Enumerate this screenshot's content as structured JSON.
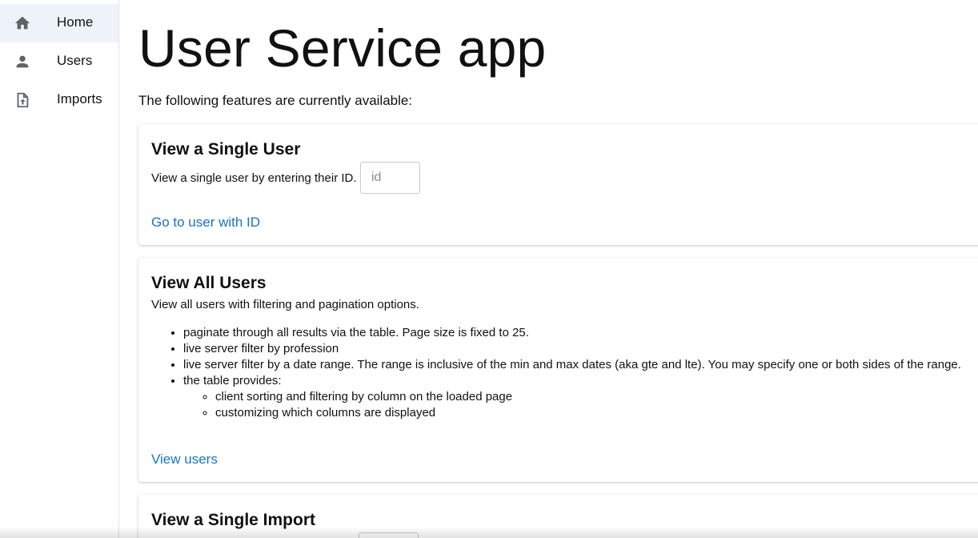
{
  "sidebar": {
    "items": [
      {
        "label": "Home",
        "icon": "home-icon",
        "active": true
      },
      {
        "label": "Users",
        "icon": "person-icon",
        "active": false
      },
      {
        "label": "Imports",
        "icon": "file-upload-icon",
        "active": false
      }
    ]
  },
  "main": {
    "title": "User Service app",
    "intro": "The following features are currently available:",
    "cards": {
      "single_user": {
        "title": "View a Single User",
        "description": "View a single user by entering their ID.",
        "input_placeholder": "id",
        "input_value": "",
        "link": "Go to user with ID"
      },
      "all_users": {
        "title": "View All Users",
        "description": "View all users with filtering and pagination options.",
        "features": [
          "paginate through all results via the table. Page size is fixed to 25.",
          "live server filter by profession",
          "live server filter by a date range. The range is inclusive of the min and max dates (aka gte and lte). You may specify one or both sides of the range.",
          "the table provides:"
        ],
        "table_features": [
          "client sorting and filtering by column on the loaded page",
          "customizing which columns are displayed"
        ],
        "link": "View users"
      },
      "single_import": {
        "title": "View a Single Import"
      }
    }
  },
  "colors": {
    "accent": "#1a73c8",
    "active_nav_bg": "#eef3fa",
    "icon": "#5f6368"
  }
}
